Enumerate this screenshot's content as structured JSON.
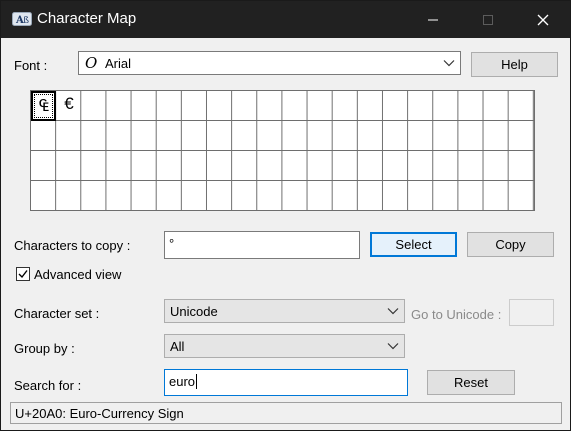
{
  "window": {
    "title": "Character Map",
    "icon": "character-map-app-icon"
  },
  "font": {
    "label": "Font :",
    "value": "Arial",
    "icon": "opentype-font-icon"
  },
  "buttons": {
    "help": "Help",
    "select": "Select",
    "copy": "Copy",
    "reset": "Reset"
  },
  "grid": {
    "cells": [
      "₠",
      "€"
    ]
  },
  "copy_field": {
    "label": "Characters to copy :",
    "value": "°"
  },
  "advanced_view": {
    "label": "Advanced view",
    "checked": true
  },
  "character_set": {
    "label": "Character set :",
    "value": "Unicode"
  },
  "goto_unicode": {
    "label": "Go to Unicode :",
    "value": ""
  },
  "group_by": {
    "label": "Group by :",
    "value": "All"
  },
  "search": {
    "label": "Search for :",
    "value": "euro"
  },
  "status": {
    "text": "U+20A0: Euro-Currency Sign"
  },
  "colors": {
    "titlebar": "#212121",
    "accent": "#0078d7",
    "window_bg": "#f0f0f0"
  }
}
